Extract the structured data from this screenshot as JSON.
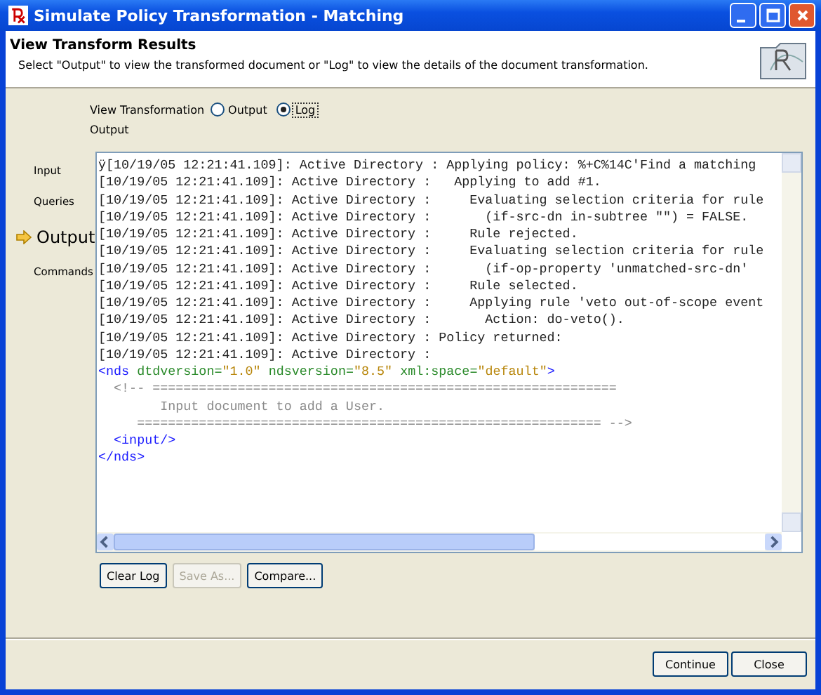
{
  "window": {
    "title": "Simulate Policy Transformation - Matching"
  },
  "header": {
    "title": "View Transform Results",
    "description": "Select \"Output\" to view the transformed document or \"Log\" to view the details of the document transformation."
  },
  "view_transformation": {
    "label": "View Transformation",
    "options": [
      {
        "label": "Output",
        "selected": false
      },
      {
        "label": "Log",
        "selected": true
      }
    ]
  },
  "section_label": "Output",
  "nav": [
    {
      "label": "Input",
      "selected": false
    },
    {
      "label": "Queries",
      "selected": false
    },
    {
      "label": "Output",
      "selected": true
    },
    {
      "label": "Commands",
      "selected": false
    }
  ],
  "log_lines": [
    {
      "kind": "log",
      "text": "ÿ[10/19/05 12:21:41.109]: Active Directory : Applying policy: %+C%14C'Find a matching"
    },
    {
      "kind": "log",
      "text": "[10/19/05 12:21:41.109]: Active Directory :   Applying to add #1."
    },
    {
      "kind": "log",
      "text": "[10/19/05 12:21:41.109]: Active Directory :     Evaluating selection criteria for rule"
    },
    {
      "kind": "log",
      "text": "[10/19/05 12:21:41.109]: Active Directory :       (if-src-dn in-subtree \"\") = FALSE."
    },
    {
      "kind": "log",
      "text": "[10/19/05 12:21:41.109]: Active Directory :     Rule rejected."
    },
    {
      "kind": "log",
      "text": "[10/19/05 12:21:41.109]: Active Directory :     Evaluating selection criteria for rule"
    },
    {
      "kind": "log",
      "text": "[10/19/05 12:21:41.109]: Active Directory :       (if-op-property 'unmatched-src-dn'"
    },
    {
      "kind": "log",
      "text": "[10/19/05 12:21:41.109]: Active Directory :     Rule selected."
    },
    {
      "kind": "log",
      "text": "[10/19/05 12:21:41.109]: Active Directory :     Applying rule 'veto out-of-scope event"
    },
    {
      "kind": "log",
      "text": "[10/19/05 12:21:41.109]: Active Directory :       Action: do-veto()."
    },
    {
      "kind": "log",
      "text": "[10/19/05 12:21:41.109]: Active Directory : Policy returned:"
    },
    {
      "kind": "log",
      "text": "[10/19/05 12:21:41.109]: Active Directory :"
    },
    {
      "kind": "xml",
      "tokens": [
        {
          "kind": "tag",
          "text": "<nds"
        },
        {
          "kind": "attr",
          "text": " dtdversion="
        },
        {
          "kind": "value",
          "text": "\"1.0\""
        },
        {
          "kind": "attr",
          "text": " ndsversion="
        },
        {
          "kind": "value",
          "text": "\"8.5\""
        },
        {
          "kind": "attr",
          "text": " xml:space="
        },
        {
          "kind": "value",
          "text": "\"default\""
        },
        {
          "kind": "tag",
          "text": ">"
        }
      ]
    },
    {
      "kind": "xml",
      "tokens": [
        {
          "kind": "comment",
          "text": "  <!-- ============================================================"
        }
      ]
    },
    {
      "kind": "xml",
      "tokens": [
        {
          "kind": "comment",
          "text": "        Input document to add a User."
        }
      ]
    },
    {
      "kind": "xml",
      "tokens": [
        {
          "kind": "comment",
          "text": "     ============================================================ -->"
        }
      ]
    },
    {
      "kind": "xml",
      "tokens": [
        {
          "kind": "tag",
          "text": "  <input/>"
        }
      ]
    },
    {
      "kind": "xml",
      "tokens": [
        {
          "kind": "tag",
          "text": "</nds>"
        }
      ]
    }
  ],
  "log_buttons": [
    {
      "label": "Clear Log",
      "disabled": false
    },
    {
      "label": "Save As...",
      "disabled": true
    },
    {
      "label": "Compare...",
      "disabled": false
    }
  ],
  "footer_buttons": [
    {
      "label": "Continue"
    },
    {
      "label": "Close"
    }
  ]
}
